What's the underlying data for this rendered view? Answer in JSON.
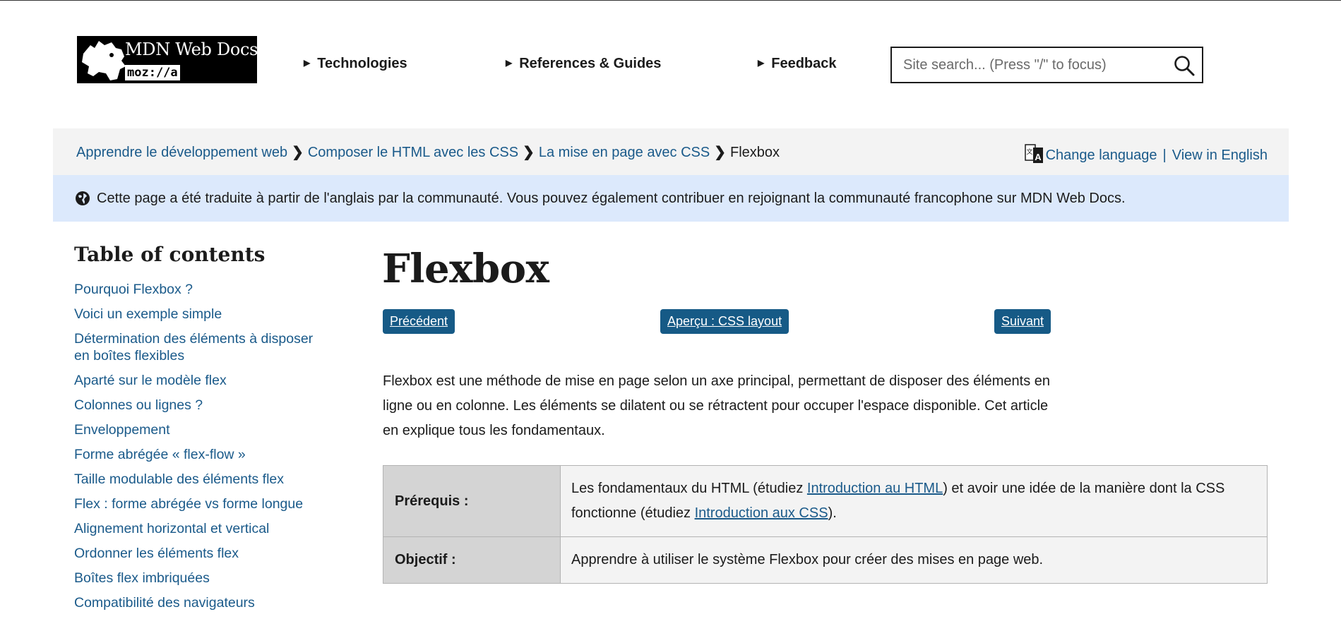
{
  "header": {
    "logo": {
      "brand": "MDN Web Docs",
      "sub": "moz://a"
    },
    "nav": [
      {
        "label": "Technologies"
      },
      {
        "label": "References & Guides"
      },
      {
        "label": "Feedback"
      }
    ],
    "search": {
      "placeholder": "Site search... (Press \"/\" to focus)",
      "icon": "search-icon"
    }
  },
  "breadcrumb": {
    "items": [
      "Apprendre le développement web",
      "Composer le HTML avec les CSS",
      "La mise en page avec CSS"
    ],
    "current": "Flexbox"
  },
  "language": {
    "change": "Change language",
    "separator": "|",
    "english": "View in English"
  },
  "notice": {
    "text": "Cette page a été traduite à partir de l'anglais par la communauté. Vous pouvez également contribuer en rejoignant la communauté francophone sur MDN Web Docs."
  },
  "toc": {
    "title": "Table of contents",
    "items": [
      "Pourquoi Flexbox ?",
      "Voici un exemple simple",
      "Détermination des éléments à disposer en boîtes flexibles",
      "Aparté sur le modèle flex",
      "Colonnes ou lignes ?",
      "Enveloppement",
      "Forme abrégée « flex-flow »",
      "Taille modulable des éléments flex",
      "Flex : forme abrégée vs forme longue",
      "Alignement horizontal et vertical",
      "Ordonner les éléments flex",
      "Boîtes flex imbriquées",
      "Compatibilité des navigateurs"
    ]
  },
  "main": {
    "title": "Flexbox",
    "buttons": {
      "previous": "Précédent",
      "overview": "Aperçu : CSS layout",
      "next": "Suivant"
    },
    "intro": "Flexbox est une méthode de mise en page selon un axe principal, permettant de disposer des éléments en ligne ou en colonne. Les éléments se dilatent ou se rétractent pour occuper l'espace disponible. Cet article en explique tous les fondamentaux.",
    "table": {
      "prereq_label": "Prérequis :",
      "prereq_text1": "Les fondamentaux du HTML (étudiez ",
      "prereq_link1": "Introduction au HTML",
      "prereq_text2": ") et avoir une idée de la manière dont la CSS fonctionne (étudiez ",
      "prereq_link2": "Introduction aux CSS",
      "prereq_text3": ").",
      "objective_label": "Objectif :",
      "objective_text": "Apprendre à utiliser le système Flexbox pour créer des mises en page web."
    }
  }
}
